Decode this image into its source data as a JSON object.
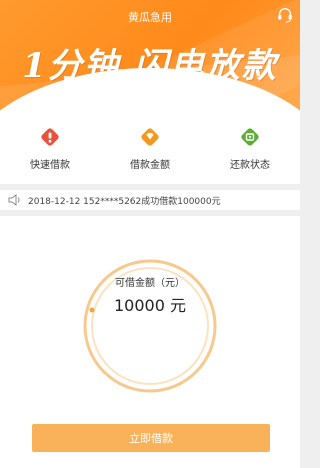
{
  "header": {
    "app_title": "黄瓜急用",
    "slogan": "1分钟 闪电放款",
    "support_icon": "headset-icon"
  },
  "quick_menu": [
    {
      "label": "快速借款",
      "icon": "diamond-red-icon",
      "color": "#e8533c"
    },
    {
      "label": "借款金额",
      "icon": "diamond-orange-icon",
      "color": "#f39a1e"
    },
    {
      "label": "还款状态",
      "icon": "diamond-green-icon",
      "color": "#5bb034"
    }
  ],
  "notice": {
    "icon": "speaker-icon",
    "text": "2018-12-12  152****5262成功借款100000元"
  },
  "loan": {
    "label": "可借金额（元）",
    "amount": "10000 元"
  },
  "borrow_button": {
    "label": "立即借款"
  },
  "colors": {
    "brand_orange": "#ff8c1e",
    "button": "#f9b25a",
    "ring": "#f7c98d"
  }
}
